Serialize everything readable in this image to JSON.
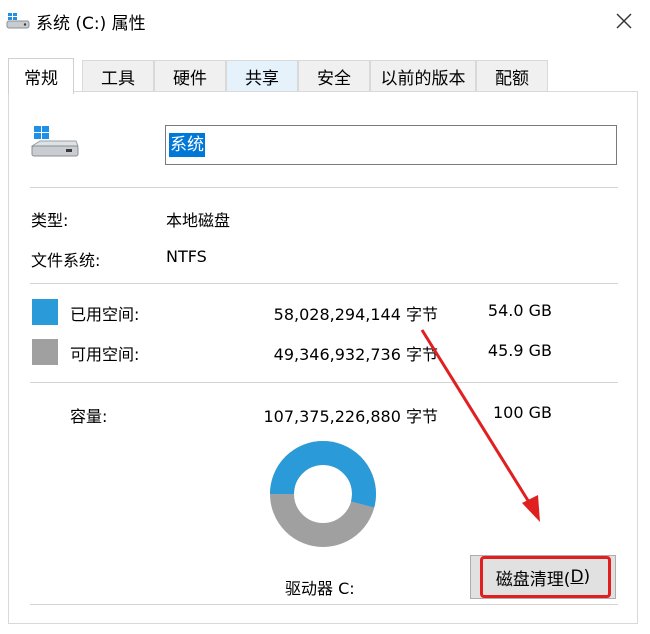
{
  "window": {
    "title": "系统 (C:) 属性",
    "close_icon": "close-icon"
  },
  "tabs": [
    "常规",
    "工具",
    "硬件",
    "共享",
    "安全",
    "以前的版本",
    "配额"
  ],
  "active_tab": "常规",
  "drive": {
    "name_value": "系统",
    "icon": "drive-icon"
  },
  "info": {
    "type_label": "类型:",
    "type_value": "本地磁盘",
    "fs_label": "文件系统:",
    "fs_value": "NTFS"
  },
  "space": {
    "used_label": "已用空间:",
    "used_bytes": "58,028,294,144 字节",
    "used_gb": "54.0 GB",
    "free_label": "可用空间:",
    "free_bytes": "49,346,932,736 字节",
    "free_gb": "45.9 GB",
    "capacity_label": "容量:",
    "capacity_bytes": "107,375,226,880 字节",
    "capacity_gb": "100 GB",
    "used_fraction": 0.54
  },
  "drive_label": "驱动器 C:",
  "cleanup_button": {
    "label_main": "磁盘清理(",
    "label_key": "D",
    "label_end": ")"
  },
  "colors": {
    "used": "#2b9ad9",
    "free": "#a0a0a0",
    "annotation": "#e02020",
    "selection": "#0078d7"
  }
}
